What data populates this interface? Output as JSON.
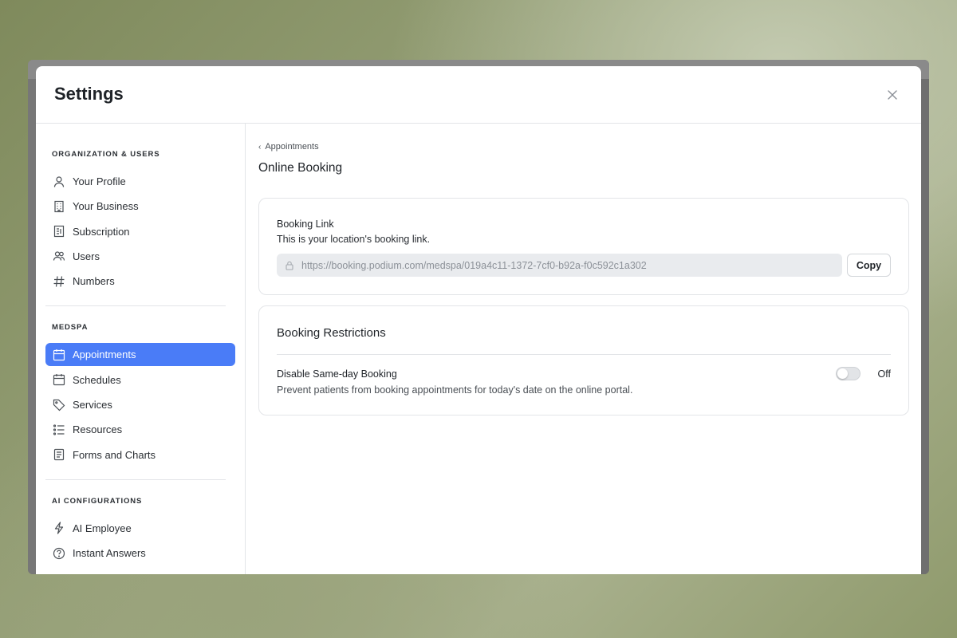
{
  "modal": {
    "title": "Settings"
  },
  "sidebar": {
    "sections": [
      {
        "title": "ORGANIZATION & USERS",
        "items": [
          {
            "label": "Your Profile",
            "icon": "user-icon"
          },
          {
            "label": "Your Business",
            "icon": "building-icon"
          },
          {
            "label": "Subscription",
            "icon": "receipt-icon"
          },
          {
            "label": "Users",
            "icon": "users-icon"
          },
          {
            "label": "Numbers",
            "icon": "hash-icon"
          }
        ]
      },
      {
        "title": "MEDSPA",
        "items": [
          {
            "label": "Appointments",
            "icon": "calendar-icon",
            "active": true
          },
          {
            "label": "Schedules",
            "icon": "calendar-icon"
          },
          {
            "label": "Services",
            "icon": "tag-icon"
          },
          {
            "label": "Resources",
            "icon": "list-icon"
          },
          {
            "label": "Forms and Charts",
            "icon": "document-icon"
          }
        ]
      },
      {
        "title": "AI CONFIGURATIONS",
        "items": [
          {
            "label": "AI Employee",
            "icon": "lightning-icon"
          },
          {
            "label": "Instant Answers",
            "icon": "question-circle-icon"
          }
        ]
      }
    ]
  },
  "content": {
    "breadcrumb": "Appointments",
    "page_title": "Online Booking",
    "booking_link": {
      "label": "Booking Link",
      "description": "This is your location's booking link.",
      "url": "https://booking.podium.com/medspa/019a4c11-1372-7cf0-b92a-f0c592c1a302",
      "copy_label": "Copy"
    },
    "restrictions": {
      "title": "Booking Restrictions",
      "setting_label": "Disable Same-day Booking",
      "setting_description": "Prevent patients from booking appointments for today's date on the online portal.",
      "toggle_state": "Off"
    }
  },
  "colors": {
    "accent": "#4a7cf7",
    "border": "#e3e5e8"
  }
}
